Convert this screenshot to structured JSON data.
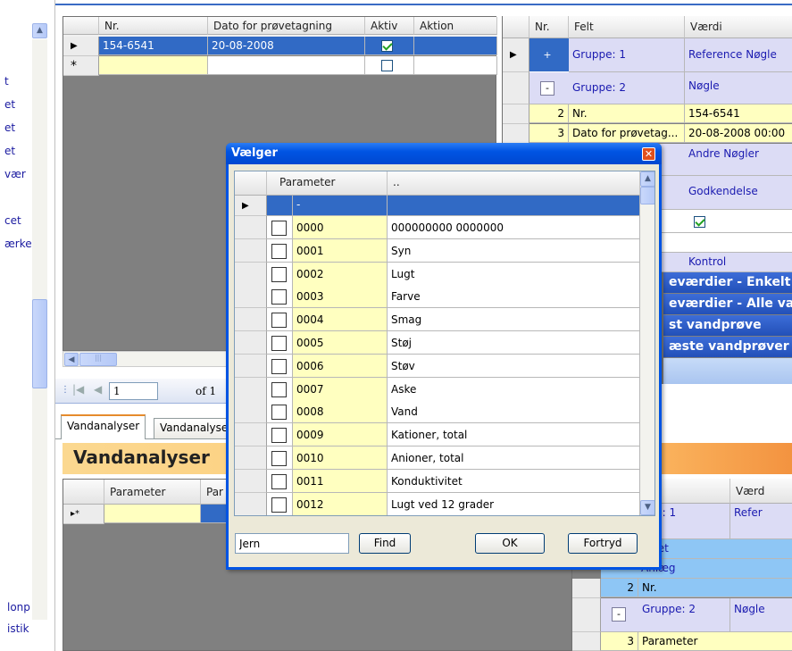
{
  "left_nav": {
    "items": [
      "t",
      "et",
      "et",
      "et",
      "vær",
      "cet",
      "ærke"
    ],
    "bottom_items": [
      "lonp",
      "istik"
    ]
  },
  "top_left_grid": {
    "columns": [
      "Nr.",
      "Dato for prøvetagning",
      "Aktiv",
      "Aktion"
    ],
    "rows": [
      {
        "nr": "154-6541",
        "dato": "20-08-2008",
        "aktiv": true
      }
    ],
    "new_row_marker": "*"
  },
  "navigator": {
    "position": "1",
    "of_label": "of 1"
  },
  "tabs": [
    "Vandanalyser",
    "Vandanalyser"
  ],
  "section_title": "Vandanalyser",
  "bottom_left_grid": {
    "columns": [
      "Parameter",
      "Par"
    ],
    "row_marker": "▸*"
  },
  "top_right_grid": {
    "columns": [
      "Nr.",
      "Felt",
      "Værdi"
    ],
    "rows": [
      {
        "nr": "+",
        "felt": "Gruppe: 1",
        "vaerdi": "Reference Nøgle"
      },
      {
        "nr": "-",
        "felt": "Gruppe: 2",
        "vaerdi": "Nøgle"
      },
      {
        "nr": "2",
        "felt": "Nr.",
        "vaerdi": "154-6541"
      },
      {
        "nr": "3",
        "felt": "Dato for prøvetag...",
        "vaerdi": "20-08-2008 00:00"
      },
      {
        "nr": "",
        "felt": "",
        "vaerdi": "Andre Nøgler"
      },
      {
        "nr": "",
        "felt": "",
        "vaerdi": "Godkendelse"
      },
      {
        "nr": "",
        "felt": "",
        "vaerdi": ""
      },
      {
        "nr": "",
        "felt": "",
        "vaerdi": ""
      },
      {
        "nr": "",
        "felt": "",
        "vaerdi": "Kontrol"
      }
    ],
    "bands": [
      "eværdier - Enkelt",
      "eværdier - Alle va",
      "st vandprøve",
      "æste vandprøver"
    ]
  },
  "bottom_right_grid": {
    "col_header": "Værd",
    "rows": [
      {
        "nr": "",
        "felt": "ppe: 1",
        "vaerdi": "Refer"
      },
      {
        "nr": "",
        "felt": "alitet",
        "vaerdi": ""
      },
      {
        "nr": "",
        "felt": "Anlæg",
        "vaerdi": ""
      },
      {
        "nr": "2",
        "felt": "Nr.",
        "vaerdi": ""
      },
      {
        "nr": "-",
        "felt": "Gruppe: 2",
        "vaerdi": "Nøgle"
      },
      {
        "nr": "3",
        "felt": "Parameter",
        "vaerdi": ""
      }
    ]
  },
  "dialog": {
    "title": "Vælger",
    "columns": [
      "Parameter",
      ".."
    ],
    "first_row_code": "-",
    "rows": [
      {
        "code": "0000",
        "name": "000000000 0000000"
      },
      {
        "code": "0001",
        "name": "Syn"
      },
      {
        "code": "0002",
        "name": "Lugt"
      },
      {
        "code": "0003",
        "name": "Farve"
      },
      {
        "code": "0004",
        "name": "Smag"
      },
      {
        "code": "0005",
        "name": "Støj"
      },
      {
        "code": "0006",
        "name": "Støv"
      },
      {
        "code": "0007",
        "name": "Aske"
      },
      {
        "code": "0008",
        "name": "Vand"
      },
      {
        "code": "0009",
        "name": "Kationer, total"
      },
      {
        "code": "0010",
        "name": "Anioner, total"
      },
      {
        "code": "0011",
        "name": "Konduktivitet"
      },
      {
        "code": "0012",
        "name": "Lugt ved 12 grader"
      }
    ],
    "search_value": "Jern",
    "find_label": "Find",
    "ok_label": "OK",
    "cancel_label": "Fortryd"
  },
  "colors": {
    "selection": "#316ac5",
    "xp_title": "#0054e3",
    "yellow_cell": "#ffffc0",
    "lavender_cell": "#dcdcf5",
    "orange_header": "#ffcc66"
  }
}
